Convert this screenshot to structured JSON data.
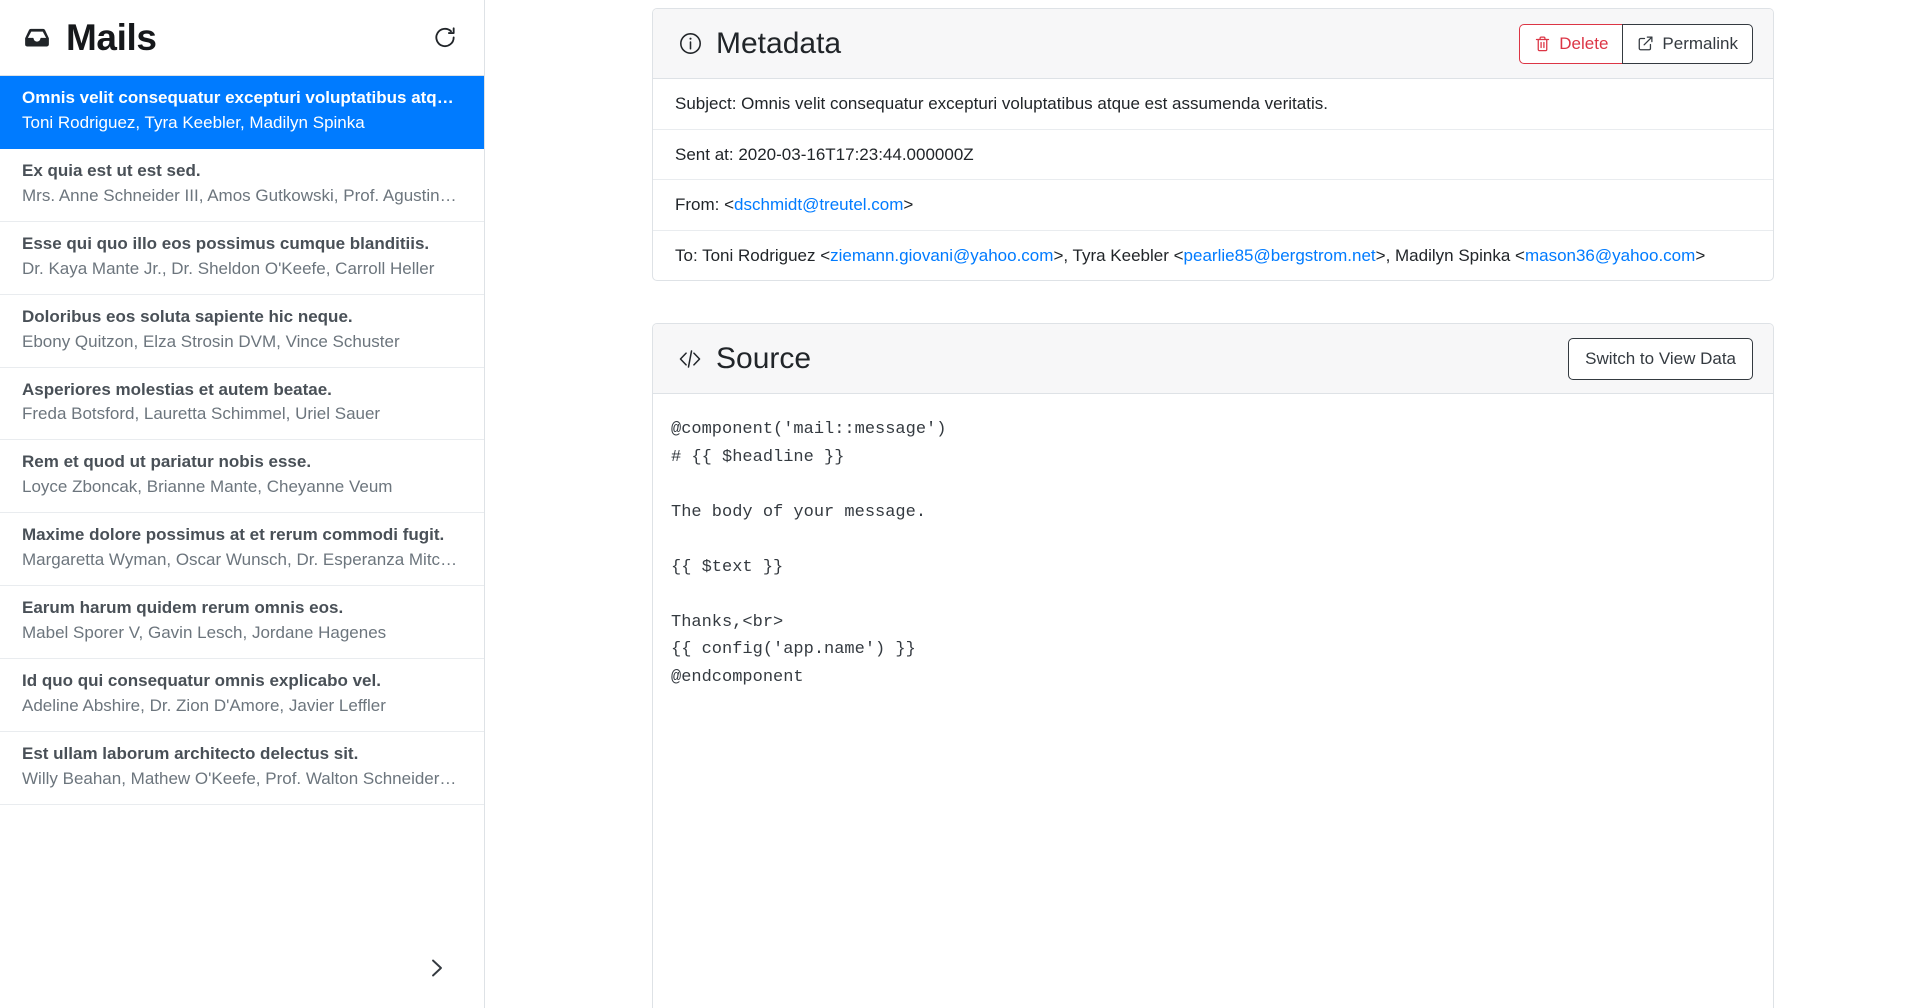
{
  "sidebar": {
    "title": "Mails",
    "inbox_icon": "inbox-icon",
    "refresh_icon": "refresh-icon",
    "next_page_icon": "chevron-right-icon",
    "items": [
      {
        "subject": "Omnis velit consequatur excepturi voluptatibus atque e…",
        "recipients": "Toni Rodriguez, Tyra Keebler, Madilyn Spinka",
        "active": true
      },
      {
        "subject": "Ex quia est ut est sed.",
        "recipients": "Mrs. Anne Schneider III, Amos Gutkowski, Prof. Agustin Pa…",
        "active": false
      },
      {
        "subject": "Esse qui quo illo eos possimus cumque blanditiis.",
        "recipients": "Dr. Kaya Mante Jr., Dr. Sheldon O'Keefe, Carroll Heller",
        "active": false
      },
      {
        "subject": "Doloribus eos soluta sapiente hic neque.",
        "recipients": "Ebony Quitzon, Elza Strosin DVM, Vince Schuster",
        "active": false
      },
      {
        "subject": "Asperiores molestias et autem beatae.",
        "recipients": "Freda Botsford, Lauretta Schimmel, Uriel Sauer",
        "active": false
      },
      {
        "subject": "Rem et quod ut pariatur nobis esse.",
        "recipients": "Loyce Zboncak, Brianne Mante, Cheyanne Veum",
        "active": false
      },
      {
        "subject": "Maxime dolore possimus at et rerum commodi fugit.",
        "recipients": "Margaretta Wyman, Oscar Wunsch, Dr. Esperanza Mitchell …",
        "active": false
      },
      {
        "subject": "Earum harum quidem rerum omnis eos.",
        "recipients": "Mabel Sporer V, Gavin Lesch, Jordane Hagenes",
        "active": false
      },
      {
        "subject": "Id quo qui consequatur omnis explicabo vel.",
        "recipients": "Adeline Abshire, Dr. Zion D'Amore, Javier Leffler",
        "active": false
      },
      {
        "subject": "Est ullam laborum architecto delectus sit.",
        "recipients": "Willy Beahan, Mathew O'Keefe, Prof. Walton Schneider IV",
        "active": false
      }
    ]
  },
  "metadata": {
    "title": "Metadata",
    "info_icon": "info-circle-icon",
    "delete_label": "Delete",
    "delete_icon": "trash-icon",
    "permalink_label": "Permalink",
    "permalink_icon": "external-link-icon",
    "rows": {
      "subject": "Subject: Omnis velit consequatur excepturi voluptatibus atque est assumenda veritatis.",
      "sent_at": "Sent at: 2020-03-16T17:23:44.000000Z",
      "from_label": "From: <",
      "from_email": "dschmidt@treutel.com",
      "from_close": ">",
      "to_label": "To: Toni Rodriguez <",
      "to_email_1": "ziemann.giovani@yahoo.com",
      "to_sep_1": ">, Tyra Keebler <",
      "to_email_2": "pearlie85@bergstrom.net",
      "to_sep_2": ">, Madilyn Spinka <",
      "to_email_3": "mason36@yahoo.com",
      "to_close": ">"
    }
  },
  "source": {
    "title": "Source",
    "code_icon": "code-brackets-icon",
    "switch_label": "Switch to View Data",
    "code": "@component('mail::message')\n# {{ $headline }}\n\nThe body of your message.\n\n{{ $text }}\n\nThanks,<br>\n{{ config('app.name') }}\n@endcomponent"
  },
  "colors": {
    "accent": "#007bff",
    "danger": "#dc3545",
    "border": "#dee2e6",
    "muted": "#6c757d",
    "dark": "#343a40"
  }
}
